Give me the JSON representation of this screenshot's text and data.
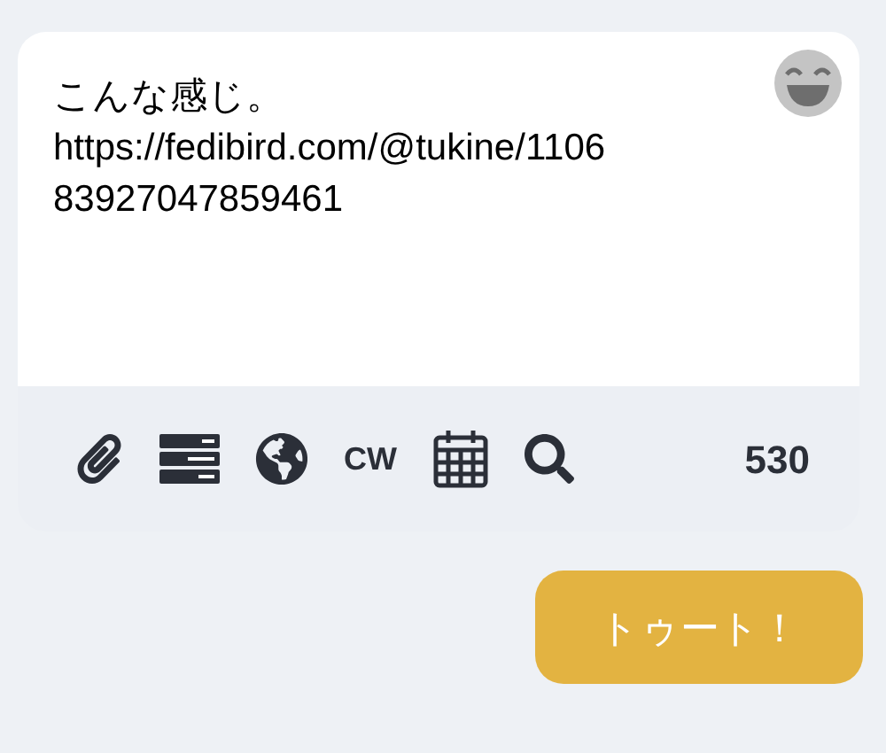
{
  "compose": {
    "value": "こんな感じ。\nhttps://fedibird.com/@tukine/110683927047859461"
  },
  "toolbar": {
    "tools": [
      {
        "kind": "attach"
      },
      {
        "kind": "poll"
      },
      {
        "kind": "visibility"
      },
      {
        "kind": "cw",
        "label": "CW"
      },
      {
        "kind": "schedule"
      },
      {
        "kind": "search"
      }
    ],
    "counter": "530"
  },
  "submit": {
    "label": "トゥート！"
  }
}
